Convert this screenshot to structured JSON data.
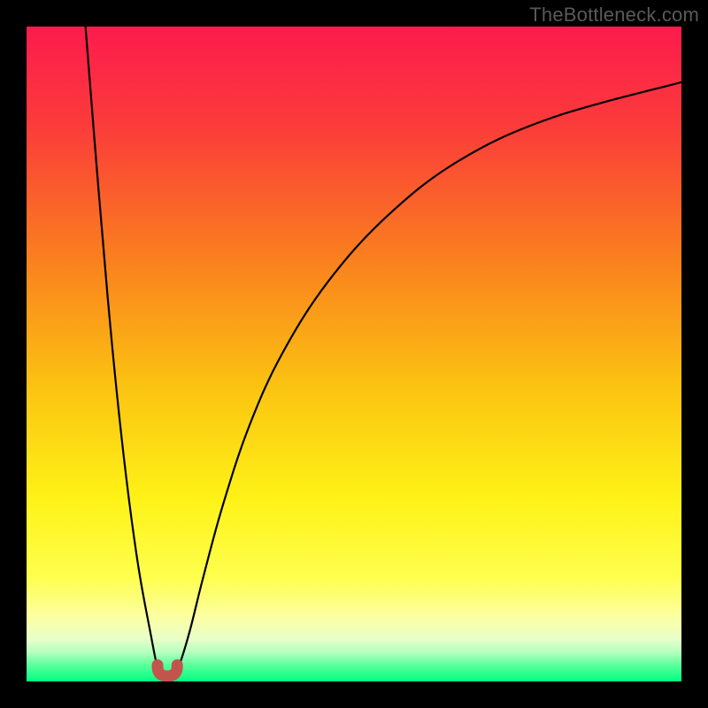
{
  "attribution": "TheBottleneck.com",
  "colors": {
    "frame": "#000000",
    "text": "#595959",
    "curve": "#000000",
    "marker_fill": "#c1554e",
    "marker_stroke": "#c1554e",
    "gradient_stops": [
      {
        "offset": 0.0,
        "color": "#fc1b4d"
      },
      {
        "offset": 0.15,
        "color": "#fb3b3a"
      },
      {
        "offset": 0.35,
        "color": "#fa7e1f"
      },
      {
        "offset": 0.55,
        "color": "#fbc311"
      },
      {
        "offset": 0.72,
        "color": "#fef217"
      },
      {
        "offset": 0.84,
        "color": "#feff4d"
      },
      {
        "offset": 0.9,
        "color": "#fcffa0"
      },
      {
        "offset": 0.935,
        "color": "#e8ffc8"
      },
      {
        "offset": 0.955,
        "color": "#b7ffbf"
      },
      {
        "offset": 0.975,
        "color": "#5bff9b"
      },
      {
        "offset": 1.0,
        "color": "#00ff83"
      }
    ]
  },
  "chart_data": {
    "type": "line",
    "title": "",
    "xlabel": "",
    "ylabel": "",
    "xlim": [
      0,
      100
    ],
    "ylim": [
      0,
      100
    ],
    "series": [
      {
        "name": "left-branch",
        "x": [
          9.0,
          11.0,
          13.0,
          15.0,
          17.0,
          19.0,
          20.0,
          20.6
        ],
        "y": [
          100.0,
          75.0,
          52.0,
          33.0,
          18.0,
          7.0,
          2.0,
          0.6
        ]
      },
      {
        "name": "right-branch",
        "x": [
          22.4,
          23.5,
          25.0,
          27.0,
          30.0,
          34.0,
          39.0,
          46.0,
          55.0,
          66.0,
          80.0,
          100.0
        ],
        "y": [
          0.6,
          3.0,
          8.0,
          16.0,
          27.0,
          39.0,
          50.0,
          61.0,
          71.0,
          79.5,
          86.0,
          91.5
        ]
      }
    ],
    "marker": {
      "name": "valley-marker",
      "shape": "U",
      "x_range": [
        20.0,
        23.0
      ],
      "y_range": [
        0.0,
        2.5
      ]
    },
    "legend": null,
    "grid": false
  }
}
